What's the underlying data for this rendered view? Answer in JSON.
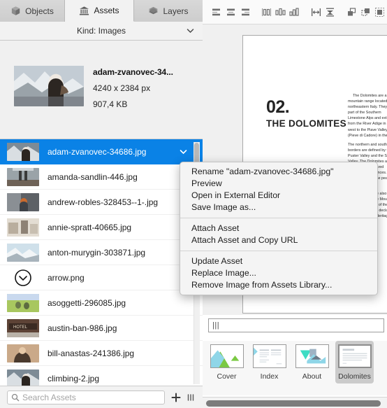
{
  "tabs": [
    {
      "label": "Objects",
      "icon": "cube-icon"
    },
    {
      "label": "Assets",
      "icon": "bank-icon"
    },
    {
      "label": "Layers",
      "icon": "layers-icon"
    }
  ],
  "filter": {
    "label": "Kind: Images",
    "chevron": "chevron-down-icon"
  },
  "preview": {
    "name": "adam-zvanovec-34...",
    "dimensions": "4240 x 2384 px",
    "filesize": "907,4 KB"
  },
  "assets": [
    {
      "name": "adam-zvanovec-34686.jpg",
      "selected": true
    },
    {
      "name": "amanda-sandlin-446.jpg",
      "selected": false
    },
    {
      "name": "andrew-robles-328453--1-.jpg",
      "selected": false
    },
    {
      "name": "annie-spratt-40665.jpg",
      "selected": false
    },
    {
      "name": "anton-murygin-303871.jpg",
      "selected": false
    },
    {
      "name": "arrow.png",
      "selected": false
    },
    {
      "name": "asoggetti-296085.jpg",
      "selected": false
    },
    {
      "name": "austin-ban-986.jpg",
      "selected": false
    },
    {
      "name": "bill-anastas-241386.jpg",
      "selected": false
    },
    {
      "name": "climbing-2.jpg",
      "selected": false
    }
  ],
  "search": {
    "placeholder": "Search Assets",
    "icon": "search-icon",
    "add": "plus-icon",
    "view": "grip-icon"
  },
  "context_menu": {
    "groups": [
      [
        "Rename \"adam-zvanovec-34686.jpg\"",
        "Preview",
        "Open in External Editor",
        "Save Image as..."
      ],
      [
        "Attach Asset",
        "Attach Asset and Copy URL"
      ],
      [
        "Update Asset",
        "Replace Image...",
        "Remove Image from Assets Library..."
      ]
    ]
  },
  "toolbar": {
    "icons": [
      "align-left-icon",
      "align-center-icon",
      "align-right-icon",
      "distribute-horizontal-icon",
      "distribute-spacing-icon",
      "distribute-vertical-icon",
      "resize-width-icon",
      "resize-height-icon",
      "bring-forward-icon",
      "send-backward-icon",
      "group-icon"
    ]
  },
  "document": {
    "number": "02.",
    "title": "THE DOLOMITES",
    "body": [
      "The Dolomites are a mountain range located in northeastern Italy. They form part of the Southern Limestone Alps and extend from the River Adige in the west to the Piave Valley (Pieve di Cadore) in the east.",
      "The northern and southern borders are defined by the Puster Valley and the Sugana Valley. The Dolomites are nearly equally shared between the provinces. Southern limestone peaks rise sharply.",
      "The Dolomites are also known as the Pale Mountains, from the structure of the rock. In 2009 they were declared a UNESCO World Heritage Site."
    ]
  },
  "page_field": {
    "value": "|||"
  },
  "pages": [
    {
      "label": "Cover",
      "active": false
    },
    {
      "label": "Index",
      "active": false
    },
    {
      "label": "About",
      "active": false
    },
    {
      "label": "Dolomites",
      "active": true
    }
  ]
}
